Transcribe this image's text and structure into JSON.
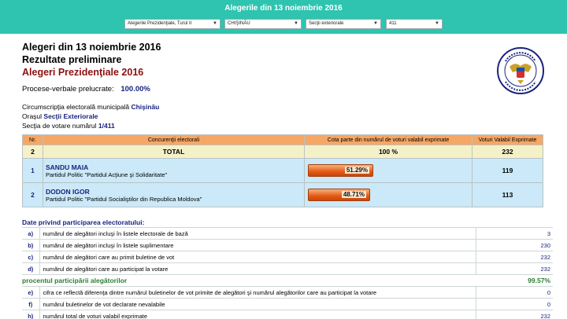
{
  "header": {
    "title": "Alegerile din 13 noiembrie 2016"
  },
  "selects": {
    "election": "Alegerile Prezidenţiale, Turul II",
    "district": "CHIŞINĂU",
    "locality": "Secţii exteriorale",
    "station": "411"
  },
  "headings": {
    "h1": "Alegeri din 13 noiembrie 2016",
    "h2": "Rezultate preliminare",
    "h3": "Alegeri Prezidenţiale 2016"
  },
  "processed": {
    "label": "Procese-verbale prelucrate:",
    "value": "100.00%"
  },
  "location": {
    "circ_label": "Circumscripţia electorală municipală",
    "circ_value": "Chişinău",
    "oras_label": "Oraşul",
    "oras_value": "Secţii Exteriorale",
    "sectia_label": "Secţia de votare numărul",
    "sectia_value": "1/411"
  },
  "results": {
    "headers": [
      "Nr.",
      "Concurenţii electorali",
      "Cota parte din numărul de voturi valabil exprimate",
      "Voturi Valabil Exprimate"
    ],
    "total": {
      "nr": "2",
      "label": "TOTAL",
      "pct": "100 %",
      "votes": "232"
    },
    "candidates": [
      {
        "nr": "1",
        "name": "SANDU MAIA",
        "party": "Partidul Politic \"Partidul Acţiune şi Solidaritate\"",
        "pct_label": "51.29%",
        "share": 0.5129,
        "votes": "119"
      },
      {
        "nr": "2",
        "name": "DODON IGOR",
        "party": "Partidul Politic \"Partidul Socialiştilor din Republica Moldova\"",
        "pct_label": "48.71%",
        "share": 0.4871,
        "votes": "113"
      }
    ]
  },
  "participation": {
    "title": "Date privind participarea electoratului:",
    "rows": [
      {
        "letter": "a)",
        "text": "numărul de alegători incluşi în listele electorale de bază",
        "value": "3"
      },
      {
        "letter": "b)",
        "text": "numărul de alegători incluşi în listele suplimentare",
        "value": "230"
      },
      {
        "letter": "c)",
        "text": "numărul de alegători care au primit buletine de vot",
        "value": "232"
      },
      {
        "letter": "d)",
        "text": "numărul de alegători care au participat la votare",
        "value": "232"
      }
    ],
    "pct_label": "procentul participării alegătorilor",
    "pct_value": "99.57%",
    "rows2": [
      {
        "letter": "e)",
        "text": "cifra ce reflectă diferenţa dintre numărul buletinelor de vot primite de alegători şi numărul alegătorilor care au participat la votare",
        "value": "0"
      },
      {
        "letter": "f)",
        "text": "numărul buletinelor de vot declarate nevalabile",
        "value": "0"
      },
      {
        "letter": "h)",
        "text": "numărul total de voturi valabil exprimate",
        "value": "232"
      }
    ]
  },
  "colors": {
    "header": "#2ec4b0",
    "th": "#f6a765",
    "total_row": "#f4f1c8",
    "cand_row": "#cbe9f8",
    "bar": "#e45a14",
    "heading_red": "#8b1010",
    "navy": "#1a237e"
  },
  "icons": {
    "emblem": "cec-moldova-seal-icon"
  }
}
